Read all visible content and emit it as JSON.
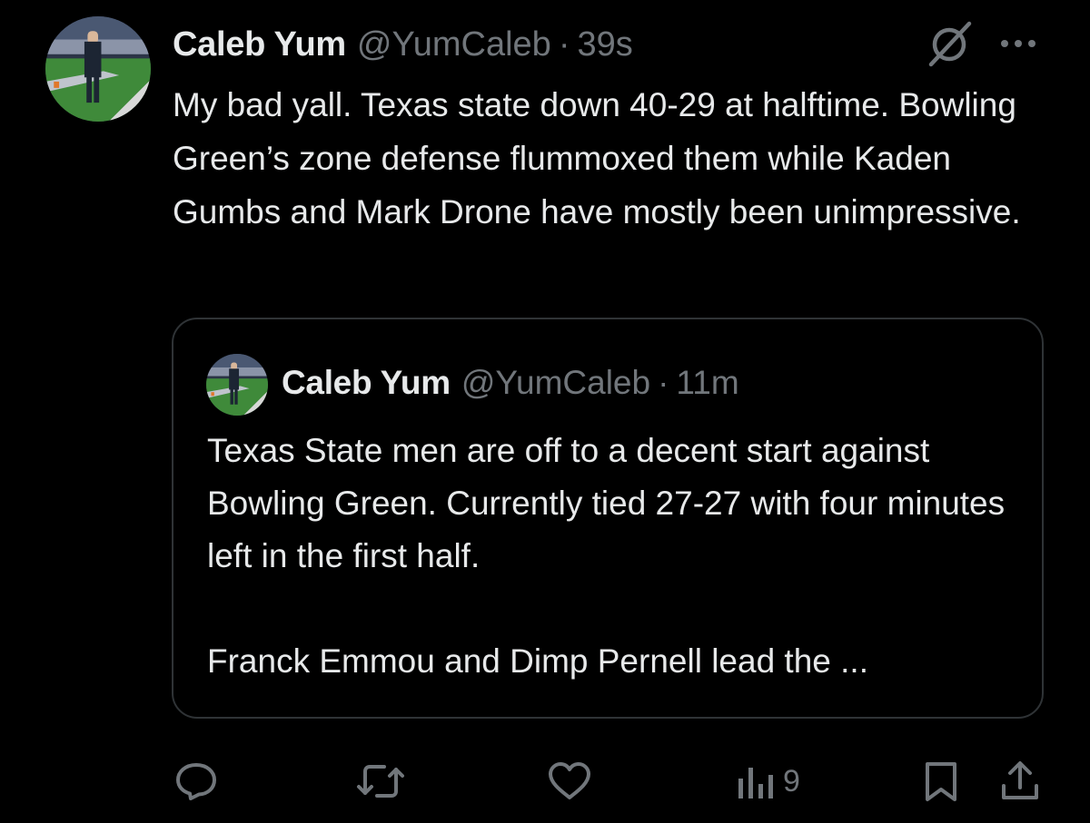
{
  "tweet": {
    "author_name": "Caleb Yum",
    "author_handle": "@YumCaleb",
    "separator": "·",
    "time": "39s",
    "text": "My bad yall. Texas state down 40-29 at halftime. Bowling Green’s zone defense flummoxed them while Kaden Gumbs and Mark Drone have mostly been unimpressive."
  },
  "quoted_tweet": {
    "author_name": "Caleb Yum",
    "author_handle": "@YumCaleb",
    "separator": "·",
    "time": "11m",
    "text_paragraph_1": "Texas State men are off to a decent start against Bowling Green. Currently tied 27-27 with four minutes left in the first half.",
    "text_paragraph_2": "Franck Emmou and Dimp Pernell lead the ..."
  },
  "actions": {
    "views_count": "9"
  },
  "icons": {
    "grok": "grok-icon",
    "more": "more-icon",
    "reply": "reply-icon",
    "retweet": "retweet-icon",
    "like": "like-icon",
    "views": "views-icon",
    "bookmark": "bookmark-icon",
    "share": "share-icon"
  },
  "colors": {
    "background": "#000000",
    "text_primary": "#e7e9ea",
    "text_secondary": "#71767b",
    "border": "#2f3336"
  }
}
